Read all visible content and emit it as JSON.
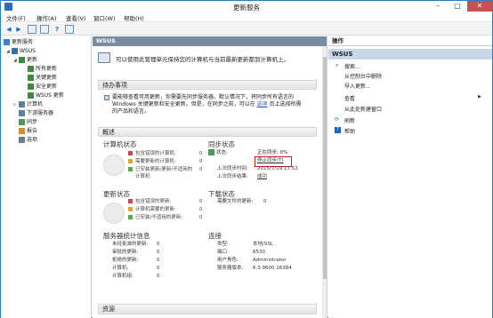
{
  "window": {
    "title": "更新服务",
    "min": "–",
    "max": "□",
    "close": "✕"
  },
  "menu": [
    "文件(F)",
    "操作(A)",
    "查看(V)",
    "窗口(W)",
    "帮助(H)"
  ],
  "tree": {
    "root": "更新服务",
    "wsus": "WSUS",
    "updates": "更新",
    "all_updates": "所有更新",
    "critical": "关键更新",
    "security": "安全更新",
    "wsus_updates": "WSUS 更新",
    "computers": "计算机",
    "downstream": "下游服务器",
    "sync": "同步",
    "reports": "报告",
    "options": "选项"
  },
  "center": {
    "header": "WSUS",
    "intro": "可以使用此管理单元保持您的计算机与当前最新更新都到计算机上。",
    "todo_title": "待办事项",
    "todo_text_1": "要能够查看可用更新，你需要先同步服务器。默认情况下，将同步所有语言的",
    "todo_text_2": "Windows 关键更新和安全更新。但是，在同步之前，可以在",
    "todo_link": "选项",
    "todo_text_3": "页上选择所需",
    "todo_text_4": "的产品和语言。",
    "overview_title": "概述",
    "computer_status": {
      "title": "计算机状态",
      "items": [
        {
          "label": "包含错误的计算机:",
          "value": "0",
          "color": "#c94a4a"
        },
        {
          "label": "需要更新的计算机:",
          "value": "0",
          "color": "#e0a43b"
        },
        {
          "label": "已安装更新/更新/不适用的",
          "value": "0",
          "color": "#58a85c"
        },
        {
          "label": "计算机",
          "value": "",
          "color": ""
        }
      ]
    },
    "sync_status": {
      "title": "同步状态",
      "status_label": "状态:",
      "status_value": "正在同步: 0%",
      "stop_link": "停止同步(T)",
      "last_sync_label": "上次同步时间:",
      "last_sync_value": "2015/7/19 17:52",
      "last_result_label": "上次同步结果:",
      "last_result_value": "成功"
    },
    "update_status": {
      "title": "更新状态",
      "items": [
        {
          "label": "包含错误的更新:",
          "value": "0",
          "color": "#c94a4a"
        },
        {
          "label": "计算机需要的更新:",
          "value": "0",
          "color": "#e0a43b"
        },
        {
          "label": "已安装/不适用的更新:",
          "value": "0",
          "color": "#58a85c"
        }
      ]
    },
    "download_status": {
      "title": "下载状态",
      "label": "需要文件的更新:",
      "value": "0"
    },
    "server_stats": {
      "title": "服务器统计信息",
      "rows": [
        {
          "label": "未经批准的更新:",
          "value": "0"
        },
        {
          "label": "审批的更新:",
          "value": "0"
        },
        {
          "label": "拒绝的更新:",
          "value": "0"
        },
        {
          "label": "计算机:",
          "value": "0"
        },
        {
          "label": "计算机组:",
          "value": "0"
        }
      ]
    },
    "connection": {
      "title": "连接",
      "rows": [
        {
          "label": "类型:",
          "value": "本地/SSL"
        },
        {
          "label": "端口:",
          "value": "8530"
        },
        {
          "label": "用户角色:",
          "value": "Administrator"
        },
        {
          "label": "服务器版本:",
          "value": "6.3.9600.16384"
        }
      ]
    },
    "resources_title": "资源"
  },
  "actions": {
    "title": "操作",
    "group": "WSUS",
    "items": [
      {
        "label": "搜索...",
        "arrow": ""
      },
      {
        "label": "从控制台中删除",
        "arrow": ""
      },
      {
        "label": "导入更新...",
        "arrow": ""
      },
      {
        "label": "查看",
        "arrow": "▶"
      },
      {
        "label": "从此处新建窗口",
        "arrow": ""
      },
      {
        "label": "刷新",
        "arrow": ""
      },
      {
        "label": "帮助",
        "arrow": ""
      }
    ]
  }
}
